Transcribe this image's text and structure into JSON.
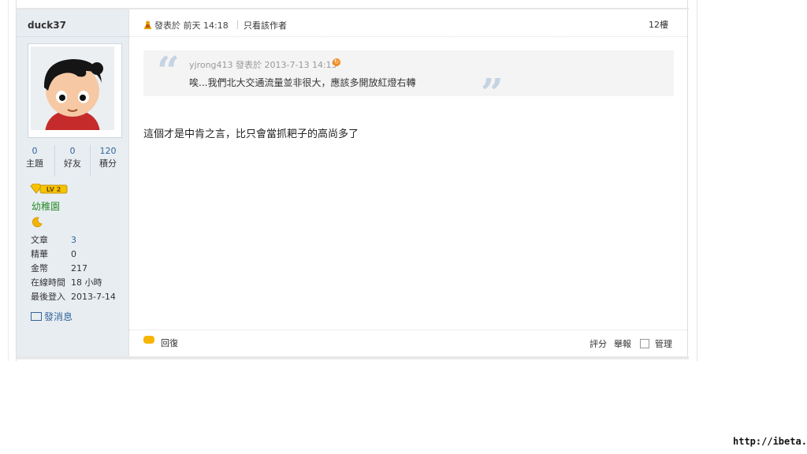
{
  "sidebar": {
    "username": "duck37",
    "stats": [
      {
        "value": "0",
        "label": "主題"
      },
      {
        "value": "0",
        "label": "好友"
      },
      {
        "value": "120",
        "label": "積分"
      }
    ],
    "rank_badge": "LV 2",
    "rank_name": "幼稚園",
    "info": [
      {
        "key": "文章",
        "value": "3"
      },
      {
        "key": "精華",
        "value": "0"
      },
      {
        "key": "金幣",
        "value": "217"
      },
      {
        "key": "在線時間",
        "value": "18 小時"
      },
      {
        "key": "最後登入",
        "value": "2013-7-14"
      }
    ],
    "send_message": "發消息"
  },
  "post": {
    "posted_meta": "發表於 前天 14:18",
    "only_author": "只看該作者",
    "floor": "12樓",
    "quote": {
      "meta": "yjrong413 發表於 2013-7-13 14:15",
      "text": "唉...我們北大交通流量並非很大，應該多開放紅燈右轉"
    },
    "body": "這個才是中肯之言，比只會當抓耙子的高尚多了",
    "footer": {
      "reply": "回復",
      "rate": "評分",
      "report": "舉報",
      "manage": "管理"
    }
  },
  "watermark": "http://ibeta.tw",
  "colors": {
    "sidebar_bg": "#e8edf2",
    "link": "#336699",
    "rank_green": "#2a8c2a",
    "quote_bg": "#f4f4f4"
  }
}
